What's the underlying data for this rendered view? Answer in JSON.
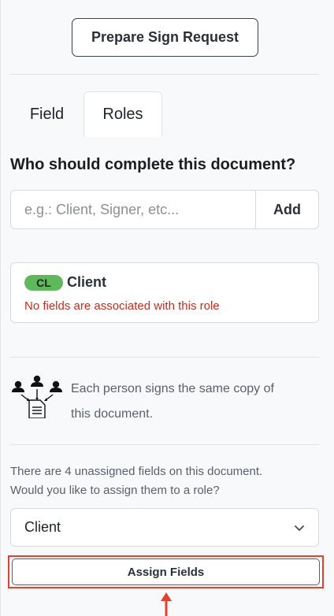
{
  "header": {
    "prepare_label": "Prepare Sign Request"
  },
  "tabs": [
    {
      "label": "Field",
      "active": false
    },
    {
      "label": "Roles",
      "active": true
    }
  ],
  "roles": {
    "question": "Who should complete this document?",
    "input": {
      "placeholder": "e.g.: Client, Signer, etc...",
      "value": ""
    },
    "add_label": "Add",
    "items": [
      {
        "badge": "CL",
        "name": "Client",
        "warning": "No fields are associated with this role",
        "badge_color": "#5fb85b"
      }
    ]
  },
  "info": {
    "icon": "people-signing-document-icon",
    "line1": "Each person signs the same copy of",
    "line2": "this document."
  },
  "assignment": {
    "line1": "There are 4 unassigned fields on this document.",
    "line2": "Would you like to assign them to a role?",
    "select_value": "Client",
    "assign_label": "Assign Fields"
  },
  "colors": {
    "highlight": "#e0422e",
    "warning": "#cc2a1e",
    "badge": "#5fb85b"
  }
}
